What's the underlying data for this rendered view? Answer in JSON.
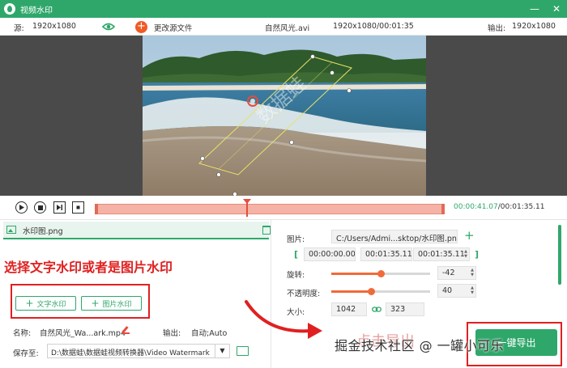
{
  "window": {
    "title": "视频水印",
    "minimize_icon": "minimize-icon",
    "close_icon": "close-icon"
  },
  "info": {
    "source_label": "源:",
    "source_res": "1920x1080",
    "change_source": "更改源文件",
    "filename": "自然风光.avi",
    "file_info": "1920x1080/00:01:35",
    "output_label": "输出:",
    "output_res": "1920x1080"
  },
  "preview": {
    "watermark_text": "数据蛙"
  },
  "playback": {
    "current": "00:00:41.07",
    "total": "/00:01:35.11"
  },
  "left": {
    "watermark_item": "水印图.png",
    "instruction": "选择文字水印或者是图片水印",
    "text_wm_button": "文字水印",
    "image_wm_button": "图片水印",
    "name_label": "名称:",
    "name_value": "自然风光_Wa...ark.mp4",
    "output_label": "输出:",
    "output_value": "自动;Auto",
    "save_label": "保存至:",
    "save_path": "D:\\数据蛙\\数据蛙视频转换器\\Video Watermark"
  },
  "right": {
    "image_label": "图片:",
    "image_path": "C:/Users/Admi...sktop/水印图.png",
    "start_time": "00:00:00.00",
    "mid_time": "00:01:35.11",
    "end_time": "00:01:35.11",
    "rotate_label": "旋转:",
    "rotate_value": "-42",
    "rotate_level": 0.5,
    "opacity_label": "不透明度:",
    "opacity_value": "40",
    "opacity_level": 0.4,
    "size_label": "大小:",
    "width": "1042",
    "height": "323"
  },
  "export": {
    "label": "一键导出",
    "ghost_text": "点击导出"
  },
  "credit": "掘金技术社区 @ 一罐小可乐",
  "colors": {
    "brand": "#2fa76a",
    "highlight": "#e02020",
    "accent": "#f06a3a"
  }
}
